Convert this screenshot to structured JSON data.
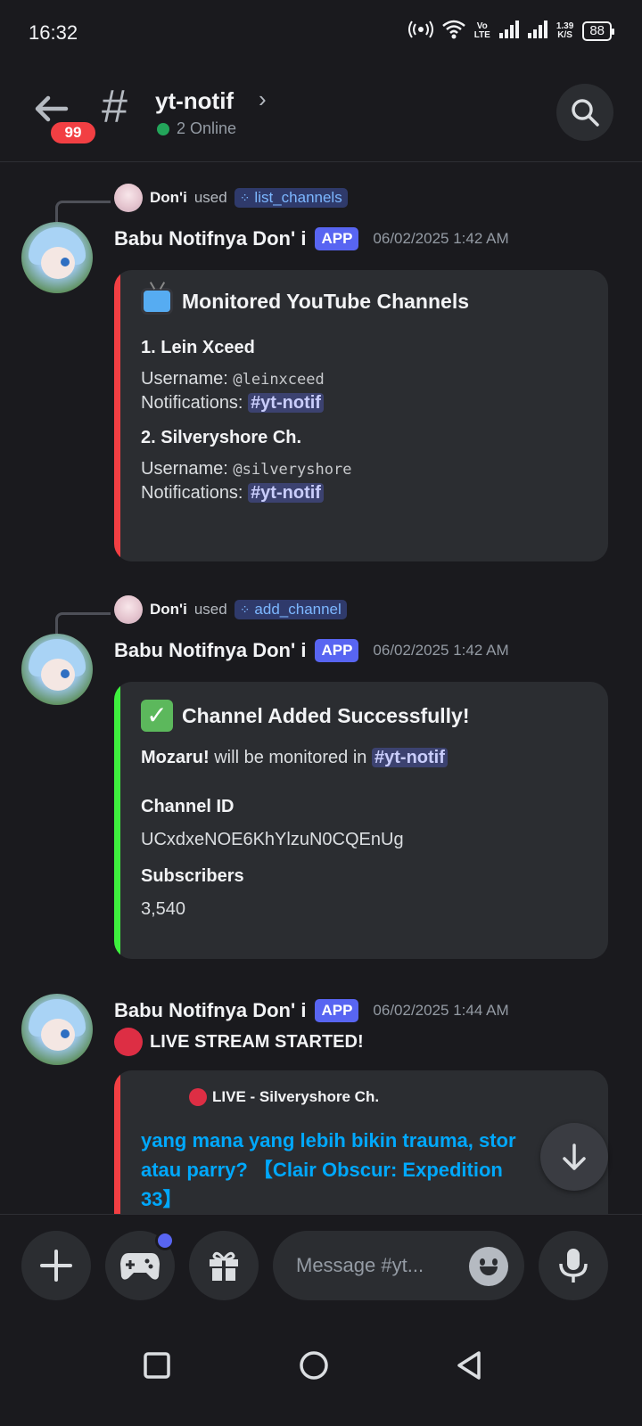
{
  "status_bar": {
    "time": "16:32",
    "network_speed_value": "1.39",
    "network_speed_unit": "K/S",
    "volte_top": "Vo",
    "volte_bottom": "LTE",
    "battery": "88"
  },
  "header": {
    "unread_count": "99",
    "channel_name": "yt-notif",
    "online_status": "2 Online"
  },
  "messages": [
    {
      "reply_user": "Don'i",
      "reply_used": "used",
      "command": "list_channels",
      "author": "Babu Notifnya Don' i",
      "tag": "APP",
      "timestamp": "06/02/2025 1:42 AM",
      "embed": {
        "title": "Monitored YouTube Channels",
        "accent_color": "#f23f43",
        "channels": [
          {
            "heading": "1. Lein Xceed",
            "username_label": "Username:",
            "username": "@leinxceed",
            "notif_label": "Notifications:",
            "notif_channel": "#yt-notif"
          },
          {
            "heading": "2. Silveryshore Ch.",
            "username_label": "Username:",
            "username": "@silveryshore",
            "notif_label": "Notifications:",
            "notif_channel": "#yt-notif"
          }
        ]
      }
    },
    {
      "reply_user": "Don'i",
      "reply_used": "used",
      "command": "add_channel",
      "author": "Babu Notifnya Don' i",
      "tag": "APP",
      "timestamp": "06/02/2025 1:42 AM",
      "embed": {
        "title": "Channel Added Successfully!",
        "accent_color": "#3ef03e",
        "desc_bold": "Mozaru!",
        "desc_text": "will be monitored in",
        "desc_channel": "#yt-notif",
        "field1_name": "Channel ID",
        "field1_value": "UCxdxeNOE6KhYlzuN0CQEnUg",
        "field2_name": "Subscribers",
        "field2_value": "3,540"
      }
    },
    {
      "author": "Babu Notifnya Don' i",
      "tag": "APP",
      "timestamp": "06/02/2025 1:44 AM",
      "content": "LIVE STREAM STARTED!",
      "embed": {
        "accent_color": "#f23f43",
        "author_line": "LIVE - Silveryshore Ch.",
        "title_line1": "yang mana yang lebih bikin trauma, stor",
        "title_line2": "atau parry? 【Clair Obscur: Expedition",
        "title_line3": "33】"
      }
    }
  ],
  "composer": {
    "placeholder": "Message #yt..."
  },
  "icons": {
    "back": "arrow-left-icon",
    "hash": "hash-icon",
    "search": "search-icon",
    "plus": "plus-icon",
    "gamepad": "gamepad-icon",
    "gift": "gift-icon",
    "emoji": "emoji-icon",
    "mic": "microphone-icon",
    "scroll": "arrow-down-icon"
  }
}
